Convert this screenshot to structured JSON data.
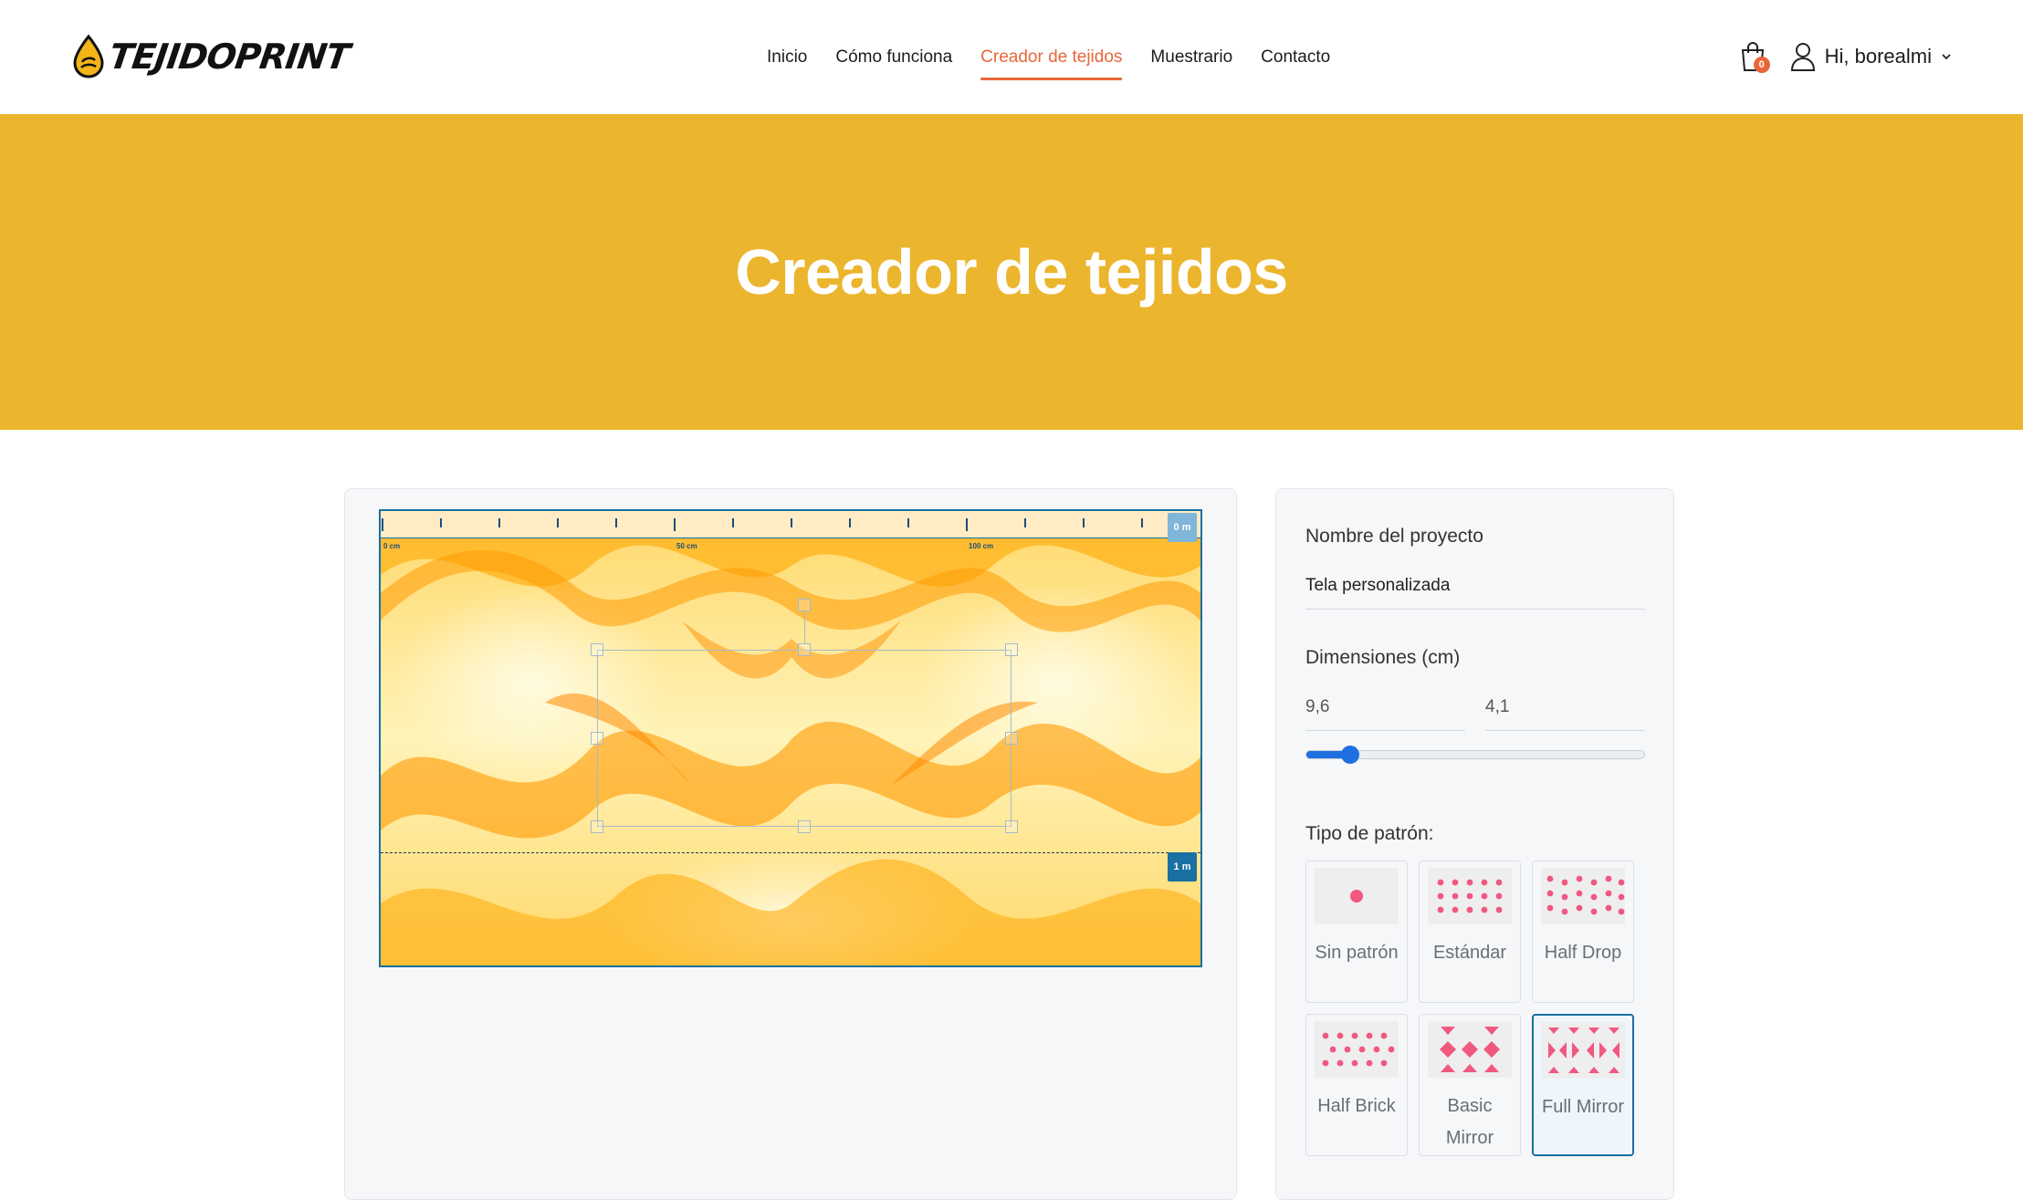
{
  "brand": {
    "name": "TEJIDOPRINT",
    "accent": "#e8663a",
    "hero_color": "#ebb52e"
  },
  "nav": {
    "items": [
      {
        "label": "Inicio",
        "active": false
      },
      {
        "label": "Cómo funciona",
        "active": false
      },
      {
        "label": "Creador de tejidos",
        "active": true
      },
      {
        "label": "Muestrario",
        "active": false
      },
      {
        "label": "Contacto",
        "active": false
      }
    ]
  },
  "header": {
    "cart_count": "0",
    "cart_icon": "shopping-bag-icon",
    "user_icon": "user-icon",
    "greeting": "Hi, borealmi"
  },
  "hero": {
    "title": "Creador de tejidos"
  },
  "editor": {
    "ruler_labels": [
      "0 cm",
      "50 cm",
      "100 cm"
    ],
    "meter_top": "0 m",
    "meter_bottom": "1 m"
  },
  "settings": {
    "project_label": "Nombre del proyecto",
    "project_value": "Tela personalizada",
    "dimensions_label": "Dimensiones (cm)",
    "width_value": "9,6",
    "height_value": "4,1",
    "slider_level": 0.13,
    "pattern_label": "Tipo de patrón:",
    "patterns": [
      {
        "name": "Sin patrón",
        "selected": false
      },
      {
        "name": "Estándar",
        "selected": false
      },
      {
        "name": "Half Drop",
        "selected": false
      },
      {
        "name": "Half Brick",
        "selected": false
      },
      {
        "name": "Basic Mirror",
        "selected": false
      },
      {
        "name": "Full Mirror",
        "selected": true
      }
    ],
    "dot_color": "#f0587f"
  }
}
